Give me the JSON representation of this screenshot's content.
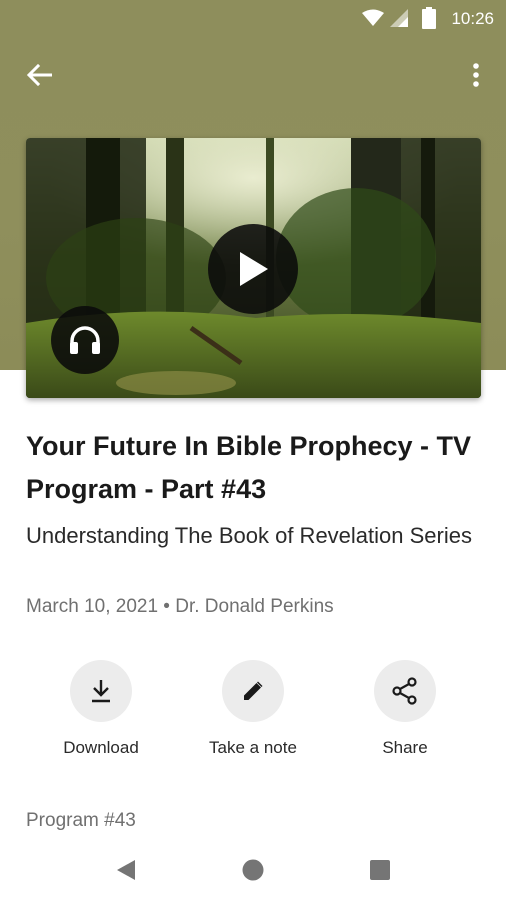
{
  "status_bar": {
    "time": "10:26"
  },
  "episode": {
    "title": "Your Future In Bible Prophecy - TV Program - Part  #43",
    "series": "Understanding The Book of Revelation Series",
    "meta": "March 10, 2021 • Dr. Donald Perkins",
    "program_label": "Program #43"
  },
  "actions": [
    {
      "label": "Download",
      "icon": "download-icon"
    },
    {
      "label": "Take a note",
      "icon": "pencil-icon"
    },
    {
      "label": "Share",
      "icon": "share-icon"
    }
  ],
  "icons": {
    "back": "arrow-back-icon",
    "more": "more-vert-icon",
    "play": "play-icon",
    "audio": "headphones-icon"
  },
  "colors": {
    "header_bg": "#8e8e5c",
    "text_primary": "#1a1a1a",
    "text_secondary": "#707070"
  }
}
